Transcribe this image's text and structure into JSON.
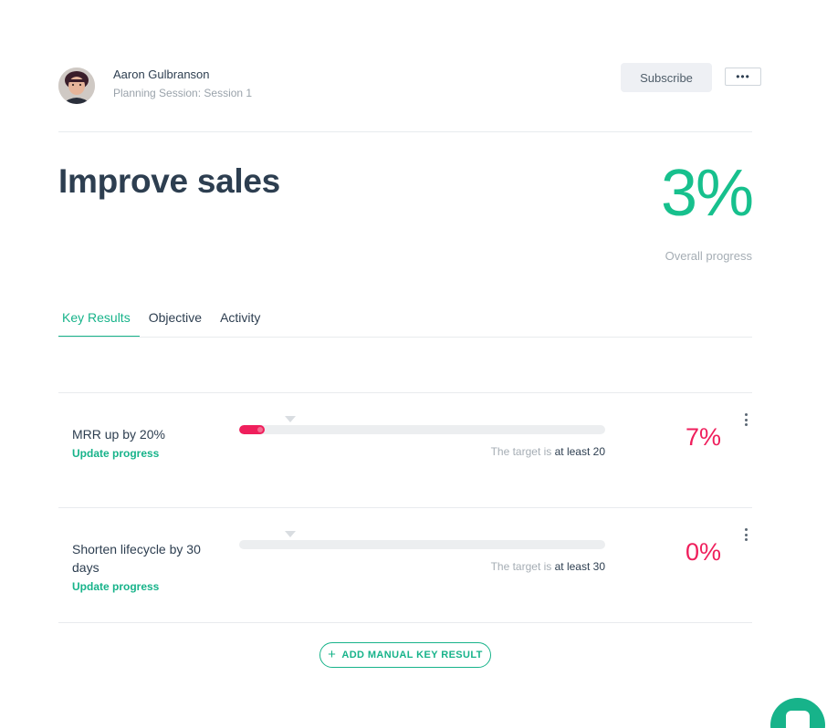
{
  "header": {
    "author_name": "Aaron Gulbranson",
    "author_subtitle": "Planning Session: Session 1",
    "subscribe_label": "Subscribe",
    "more_label": "•••"
  },
  "objective": {
    "title": "Improve sales",
    "overall_progress": "3%",
    "overall_label": "Overall progress"
  },
  "tabs": [
    {
      "label": "Key Results",
      "active": true
    },
    {
      "label": "Objective",
      "active": false
    },
    {
      "label": "Activity",
      "active": false
    }
  ],
  "key_results": [
    {
      "name": "MRR up by 20%",
      "update_label": "Update progress",
      "target_prefix": "The target is",
      "target_value": "at least 20",
      "progress_display": "7%",
      "progress_fraction": 0.07
    },
    {
      "name": "Shorten lifecycle by 30 days",
      "update_label": "Update progress",
      "target_prefix": "The target is",
      "target_value": "at least 30",
      "progress_display": "0%",
      "progress_fraction": 0.0
    }
  ],
  "actions": {
    "add_manual_label": "ADD MANUAL KEY RESULT",
    "add_icon": "plus-icon"
  },
  "colors": {
    "accent": "#17b38a",
    "progress_green": "#17c08d",
    "danger": "#ef1f5c",
    "text": "#2d3e50",
    "muted": "#a5adb4"
  }
}
